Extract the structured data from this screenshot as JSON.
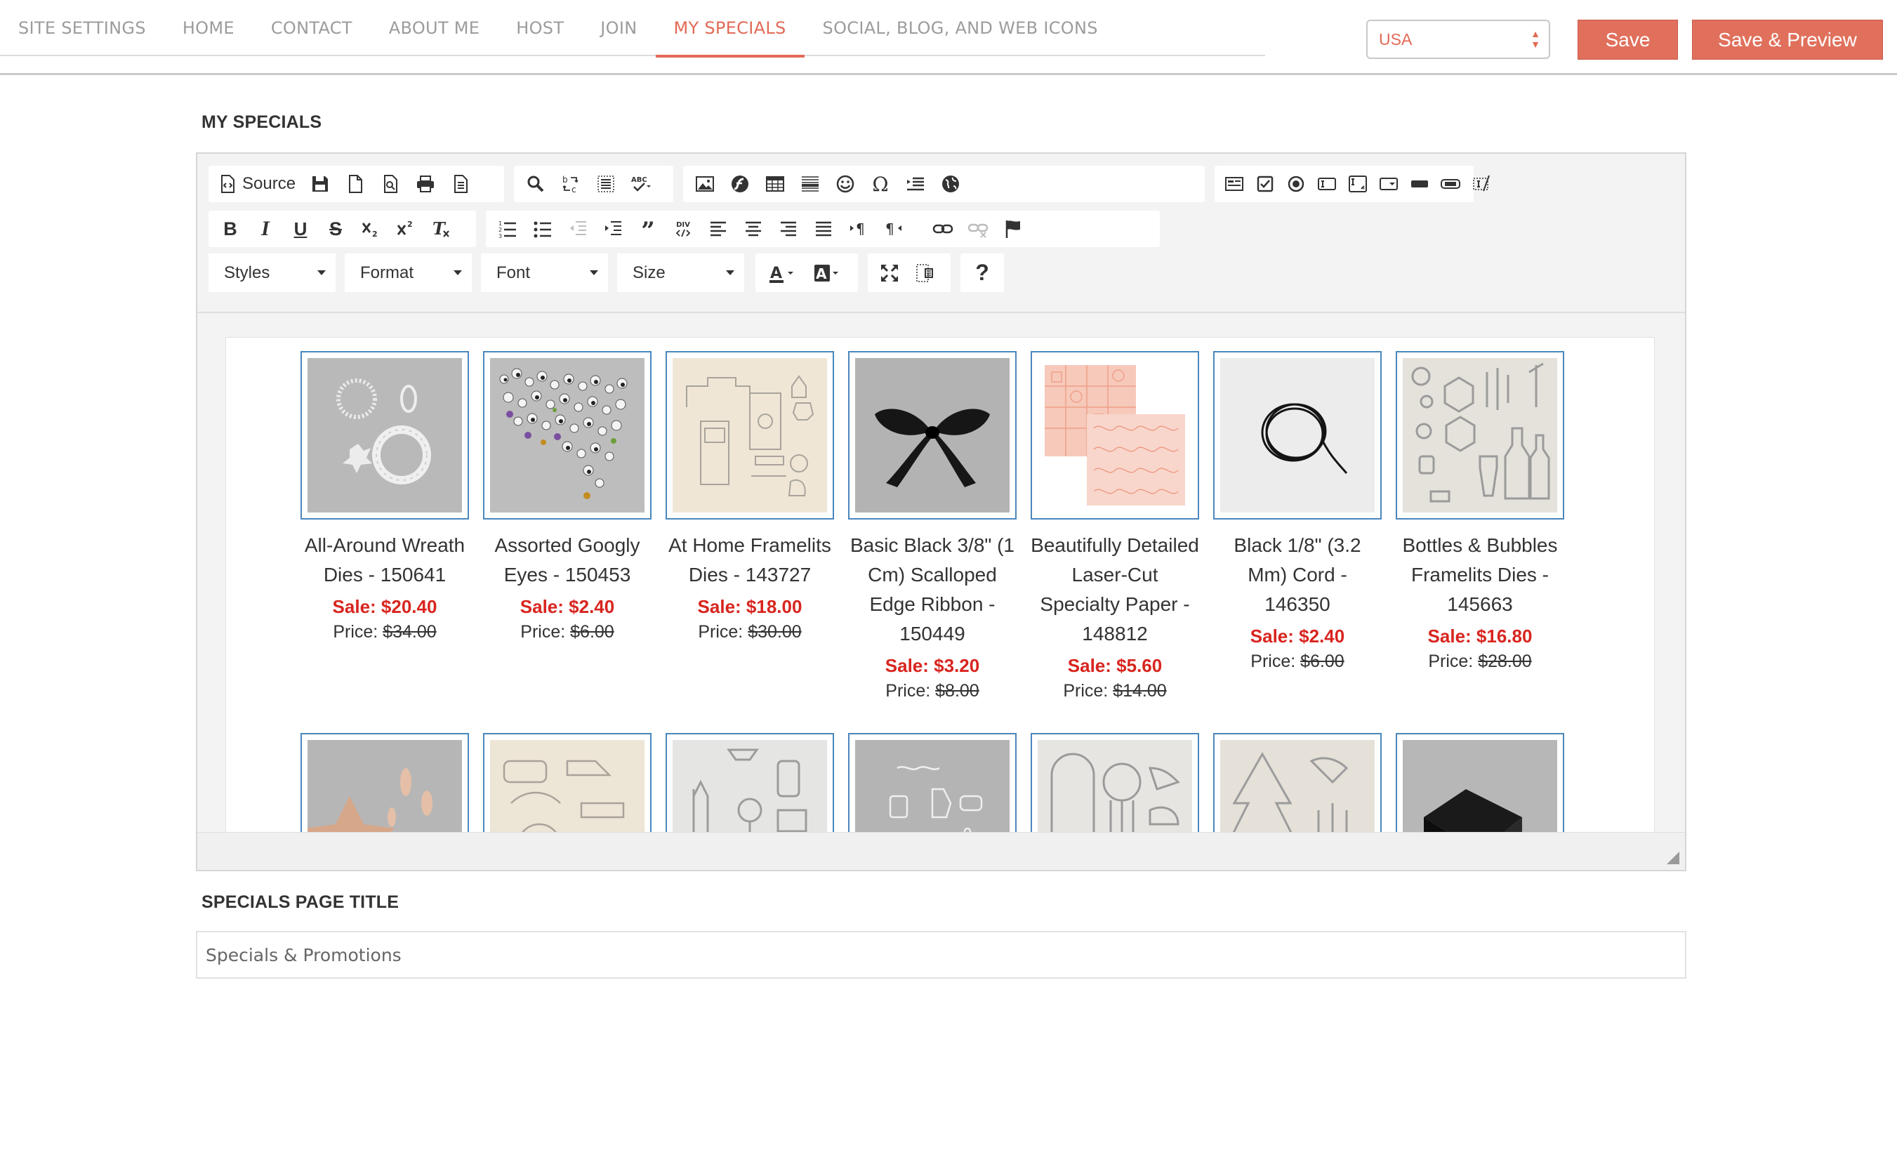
{
  "nav": {
    "tabs": [
      {
        "label": "SITE SETTINGS"
      },
      {
        "label": "HOME"
      },
      {
        "label": "CONTACT"
      },
      {
        "label": "ABOUT ME"
      },
      {
        "label": "HOST"
      },
      {
        "label": "JOIN"
      },
      {
        "label": "MY SPECIALS",
        "active": true
      },
      {
        "label": "SOCIAL, BLOG, AND WEB ICONS"
      }
    ]
  },
  "header": {
    "country": "USA",
    "save_label": "Save",
    "save_preview_label": "Save & Preview"
  },
  "specials": {
    "heading": "MY SPECIALS",
    "toolbar": {
      "source_label": "Source",
      "styles_label": "Styles",
      "format_label": "Format",
      "font_label": "Font",
      "size_label": "Size"
    },
    "products": [
      {
        "name": "All-Around Wreath Dies - 150641",
        "sale": "Sale: $20.40",
        "price_label": "Price:",
        "price": "$34.00"
      },
      {
        "name": "Assorted Googly Eyes - 150453",
        "sale": "Sale: $2.40",
        "price_label": "Price:",
        "price": "$6.00"
      },
      {
        "name": "At Home Framelits Dies - 143727",
        "sale": "Sale: $18.00",
        "price_label": "Price:",
        "price": "$30.00"
      },
      {
        "name": "Basic Black 3/8\" (1 Cm) Scalloped Edge Ribbon - 150449",
        "sale": "Sale: $3.20",
        "price_label": "Price:",
        "price": "$8.00"
      },
      {
        "name": "Beautifully Detailed Laser-Cut Specialty Paper - 148812",
        "sale": "Sale: $5.60",
        "price_label": "Price:",
        "price": "$14.00"
      },
      {
        "name": "Black 1/8\" (3.2 Mm) Cord - 146350",
        "sale": "Sale: $2.40",
        "price_label": "Price:",
        "price": "$6.00"
      },
      {
        "name": "Bottles & Bubbles Framelits Dies - 145663",
        "sale": "Sale: $16.80",
        "price_label": "Price:",
        "price": "$28.00"
      }
    ]
  },
  "page_title": {
    "heading": "SPECIALS PAGE TITLE",
    "value": "Specials & Promotions"
  },
  "colors": {
    "accent": "#e26a56",
    "button": "#e0705c",
    "sale": "#d8251f",
    "thumb_border": "#4a87bc"
  }
}
